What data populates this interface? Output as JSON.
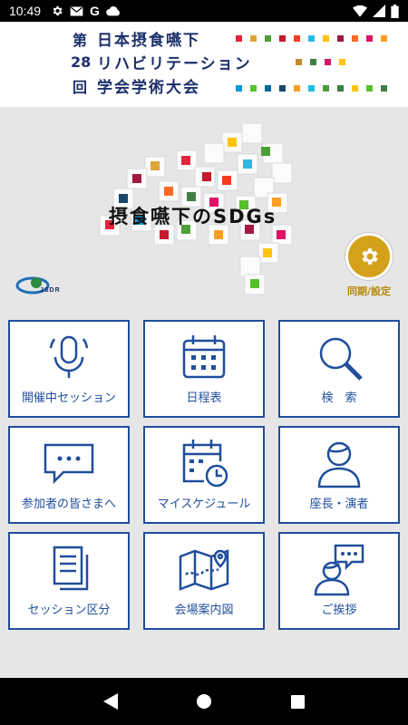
{
  "status_bar": {
    "time": "10:49",
    "icons_left": [
      "gear-icon",
      "mail-icon",
      "google-icon",
      "cloud-icon"
    ],
    "icons_right": [
      "wifi-icon",
      "signal-icon",
      "battery-icon"
    ]
  },
  "header": {
    "number_column": [
      "第",
      "28",
      "回"
    ],
    "title_lines": [
      "日本摂食嚥下",
      "リハビリテーション",
      "学会学術大会"
    ]
  },
  "hero": {
    "title": "摂食嚥下のSDGs",
    "logo_text": "JSDR",
    "sync_label": "同期/設定"
  },
  "tiles": [
    {
      "label": "開催中セッション",
      "icon": "microphone-icon"
    },
    {
      "label": "日程表",
      "icon": "calendar-icon"
    },
    {
      "label": "検　索",
      "icon": "search-icon"
    },
    {
      "label": "参加者の皆さまへ",
      "icon": "chat-bubble-icon"
    },
    {
      "label": "マイスケジュール",
      "icon": "calendar-clock-icon"
    },
    {
      "label": "座長・演者",
      "icon": "person-icon"
    },
    {
      "label": "セッション区分",
      "icon": "documents-icon"
    },
    {
      "label": "会場案内図",
      "icon": "map-icon"
    },
    {
      "label": "ご挨拶",
      "icon": "person-speech-icon"
    }
  ],
  "nav_bar": [
    "back-icon",
    "home-icon",
    "recents-icon"
  ],
  "colors": {
    "accent_blue": "#1f4e9c",
    "title_navy": "#1c2f6b",
    "sync_gold": "#d4a21a"
  }
}
